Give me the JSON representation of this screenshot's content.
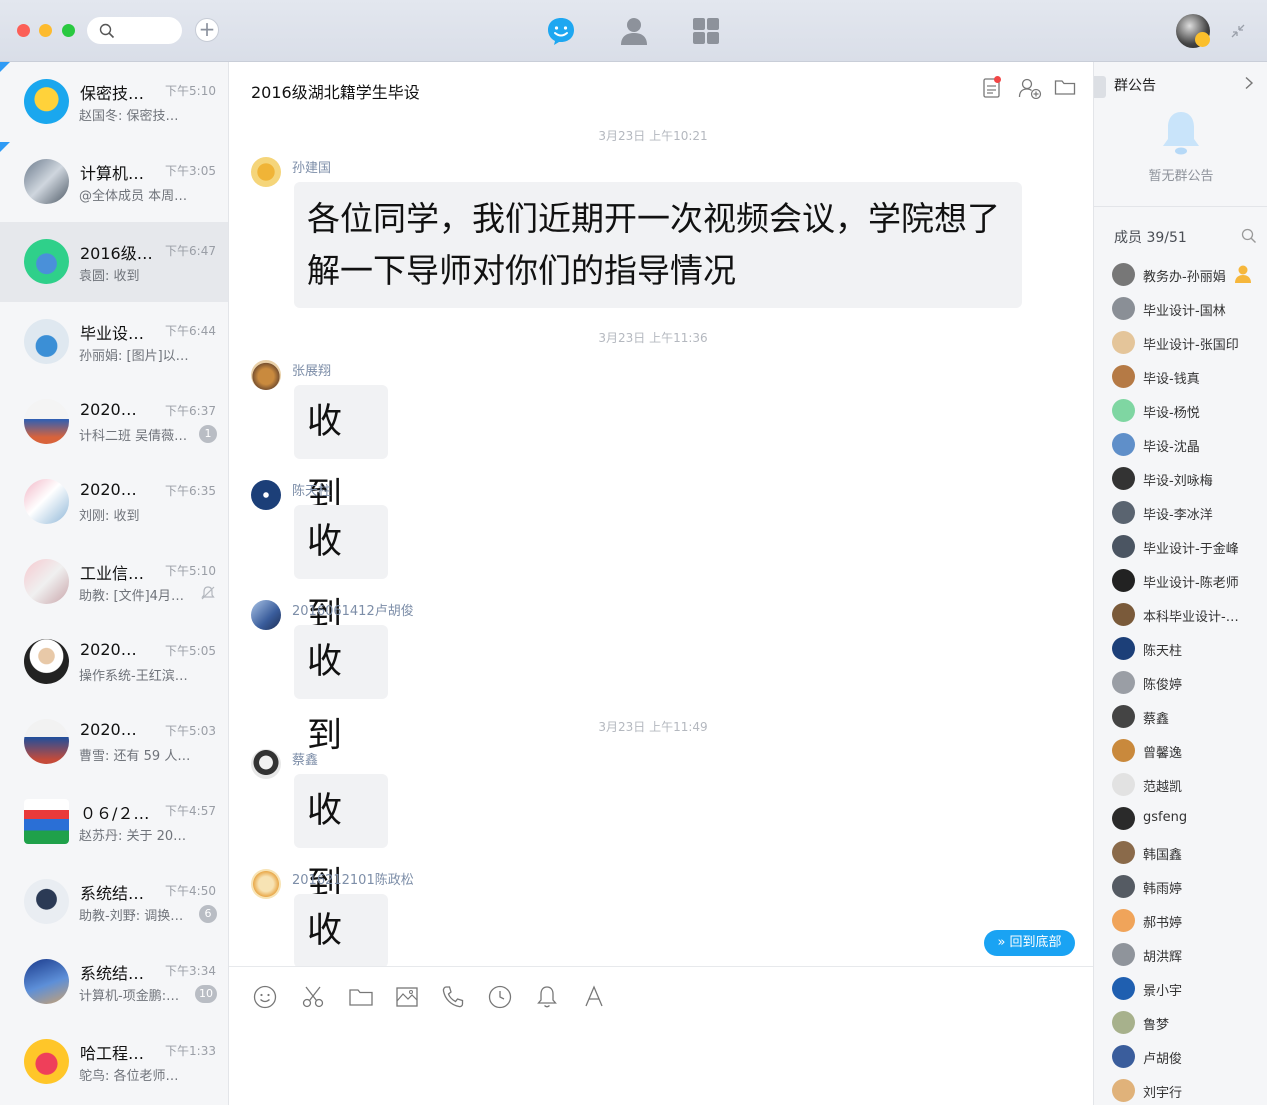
{
  "titlebar": {
    "nav": [
      "chat-bubble-icon",
      "contacts-icon",
      "apps-grid-icon"
    ]
  },
  "colors": {
    "accent": "#1aa3f3",
    "sender": "#7d8ea8",
    "badge": "#b9bdc4"
  },
  "conversations": [
    {
      "name": "保密技…",
      "time": "下午5:10",
      "preview": "赵国冬: 保密技…",
      "pinned": true
    },
    {
      "name": "计算机…",
      "time": "下午3:05",
      "preview": "@全体成员 本周…",
      "pinned": true
    },
    {
      "name": "2016级…",
      "time": "下午6:47",
      "preview": "袁圆: 收到",
      "selected": true
    },
    {
      "name": "毕业设…",
      "time": "下午6:44",
      "preview": "孙丽娟: [图片]以…"
    },
    {
      "name": "2020…",
      "time": "下午6:37",
      "preview": "计科二班 吴倩薇:…",
      "badge": "1"
    },
    {
      "name": "2020…",
      "time": "下午6:35",
      "preview": "刘刚: 收到"
    },
    {
      "name": "工业信…",
      "time": "下午5:10",
      "preview": "助教: [文件]4月1…",
      "muted": true
    },
    {
      "name": "2020…",
      "time": "下午5:05",
      "preview": "操作系统-王红滨…"
    },
    {
      "name": "2020…",
      "time": "下午5:03",
      "preview": "曹雪: 还有 59 人…"
    },
    {
      "name": "０６/２…",
      "time": "下午4:57",
      "preview": "赵苏丹: 关于 20…"
    },
    {
      "name": "系统结…",
      "time": "下午4:50",
      "preview": "助教-刘野: 调换…",
      "badge": "6"
    },
    {
      "name": "系统结…",
      "time": "下午3:34",
      "preview": "计算机-项金鹏:…",
      "badge": "10"
    },
    {
      "name": "哈工程…",
      "time": "下午1:33",
      "preview": "鸵鸟: 各位老师…"
    }
  ],
  "chat": {
    "title": "2016级湖北籍学生毕设",
    "timestamps": [
      "3月23日  上午10:21",
      "3月23日  上午11:36",
      "3月23日  上午11:49"
    ],
    "messages": [
      {
        "sender": "孙建国",
        "text": "各位同学，我们近期开一次视频会议，学院想了解一下导师对你们的指导情况"
      },
      {
        "sender": "张展翔",
        "text": "收到"
      },
      {
        "sender": "陈天柱",
        "text": "收到"
      },
      {
        "sender": "2016061412卢胡俊",
        "text": "收到"
      },
      {
        "sender": "蔡鑫",
        "text": "收到"
      },
      {
        "sender": "2016212101陈政松",
        "text": "收到"
      }
    ],
    "back_to_bottom": "回到底部",
    "toolbar": [
      "emoji-icon",
      "scissors-icon",
      "folder-icon",
      "image-icon",
      "phone-icon",
      "history-icon",
      "bell-icon",
      "font-icon"
    ]
  },
  "panel": {
    "notice_title": "群公告",
    "notice_empty": "暂无群公告",
    "members_label": "成员 39/51",
    "members": [
      "教务办-孙丽娟",
      "毕业设计-国林",
      "毕业设计-张国印",
      "毕设-钱真",
      "毕设-杨悦",
      "毕设-沈晶",
      "毕设-刘咏梅",
      "毕设-李冰洋",
      "毕业设计-于金峰",
      "毕业设计-陈老师",
      "本科毕业设计-…",
      "陈天柱",
      "陈俊婷",
      "蔡鑫",
      "曾馨逸",
      "范越凯",
      "gsfeng",
      "韩国鑫",
      "韩雨婷",
      "郝书婷",
      "胡洪辉",
      "景小宇",
      "鲁梦",
      "卢胡俊",
      "刘宇行"
    ]
  }
}
